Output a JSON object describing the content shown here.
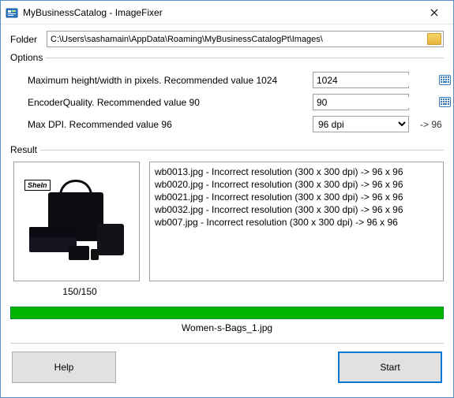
{
  "window": {
    "title": "MyBusinessCatalog - ImageFixer"
  },
  "folder": {
    "label": "Folder",
    "path": "C:\\Users\\sashamain\\AppData\\Roaming\\MyBusinessCatalogPt\\Images\\"
  },
  "options": {
    "legend": "Options",
    "maxsize_label": "Maximum height/width in pixels. Recommended value 1024",
    "maxsize_value": "1024",
    "quality_label": "EncoderQuality. Recommended value 90",
    "quality_value": "90",
    "dpi_label": "Max DPI. Recommended value 96",
    "dpi_value": "96 dpi",
    "dpi_suffix": "-> 96"
  },
  "result": {
    "legend": "Result",
    "brand": "SheIn",
    "counter": "150/150",
    "log": [
      "wb0013.jpg - Incorrect resolution (300 x 300 dpi) -> 96 x 96",
      "wb0020.jpg - Incorrect resolution (300 x 300 dpi) -> 96 x 96",
      "wb0021.jpg - Incorrect resolution (300 x 300 dpi) -> 96 x 96",
      "wb0032.jpg - Incorrect resolution (300 x 300 dpi) -> 96 x 96",
      "wb007.jpg - Incorrect resolution (300 x 300 dpi) -> 96 x 96"
    ],
    "current_file": "Women-s-Bags_1.jpg"
  },
  "buttons": {
    "help": "Help",
    "start": "Start"
  }
}
